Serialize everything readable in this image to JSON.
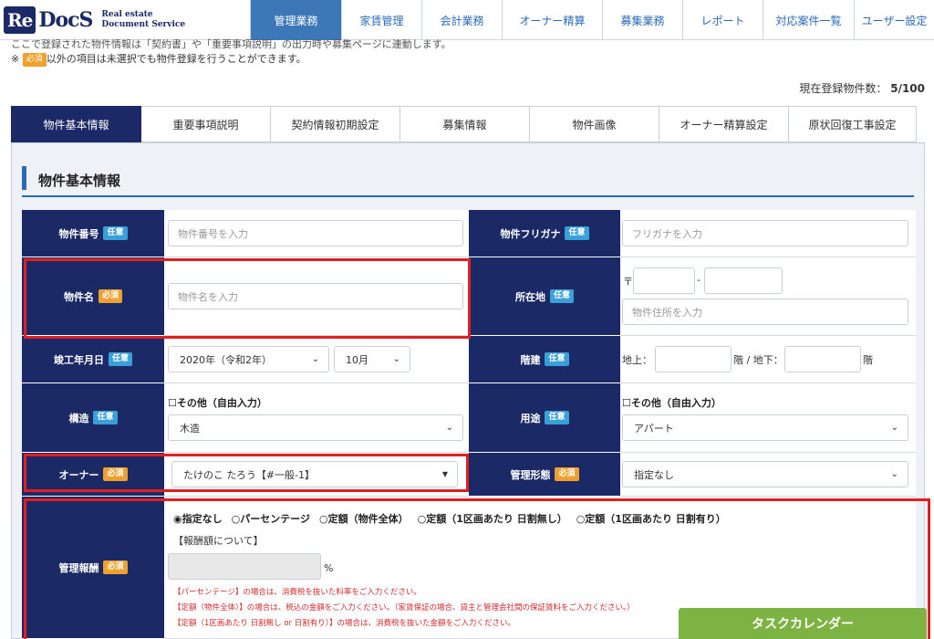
{
  "logo": {
    "mark": "Re",
    "word": "DocS",
    "sub1": "Real estate",
    "sub2": "Document Service"
  },
  "nav": [
    {
      "label": "管理業務",
      "active": true
    },
    {
      "label": "家賃管理"
    },
    {
      "label": "会計業務"
    },
    {
      "label": "オーナー精算"
    },
    {
      "label": "募集業務"
    },
    {
      "label": "レポート"
    },
    {
      "label": "対応案件一覧"
    },
    {
      "label": "ユーザー設定"
    }
  ],
  "notice": {
    "line1": "ここで登録された物件情報は「契約書」や「重要事項説明」の出力時や募集ページに連動します。",
    "line2_prefix": "※",
    "line2_badge": "必須",
    "line2_suffix": "以外の項目は未選択でも物件登録を行うことができます。"
  },
  "count": {
    "label": "現在登録物件数：",
    "value": "5/100"
  },
  "tabs": [
    "物件基本情報",
    "重要事項説明",
    "契約情報初期設定",
    "募集情報",
    "物件画像",
    "オーナー精算設定",
    "原状回復工事設定"
  ],
  "section_title": "物件基本情報",
  "badges": {
    "required": "必須",
    "optional": "任意"
  },
  "fields": {
    "property_number": {
      "label": "物件番号",
      "placeholder": "物件番号を入力"
    },
    "property_kana": {
      "label": "物件フリガナ",
      "placeholder": "フリガナを入力"
    },
    "property_name": {
      "label": "物件名",
      "placeholder": "物件名を入力"
    },
    "address": {
      "label": "所在地",
      "postal_mark": "〒",
      "dash": "-",
      "placeholder": "物件住所を入力"
    },
    "built_date": {
      "label": "竣工年月日",
      "year": "2020年（令和2年）",
      "month": "10月"
    },
    "floors": {
      "label": "階建",
      "above": "地上：",
      "mid": "階 / 地下：",
      "below_unit": "階"
    },
    "structure": {
      "label": "構造",
      "other": "☐その他（自由入力）",
      "value": "木造"
    },
    "usage": {
      "label": "用途",
      "other": "☐その他（自由入力）",
      "value": "アパート"
    },
    "owner": {
      "label": "オーナー",
      "value": "たけのこ たろう【#一般-1】"
    },
    "mgmt_type": {
      "label": "管理形態",
      "value": "指定なし"
    },
    "mgmt_fee": {
      "label": "管理報酬",
      "options": [
        "◉指定なし",
        "○パーセンテージ",
        "○定額（物件全体）",
        "○定額（1区画あたり 日割無し）",
        "○定額（1区画あたり 日割有り）"
      ],
      "link": "【報酬額について】",
      "unit": "%",
      "notes": [
        "【パーセンテージ】の場合は、消費税を抜いた料率をご入力ください。",
        "【定額（物件全体）】の場合は、税込の金額をご入力ください。（家賃保証の場合、貸主と管理会社間の保証賃料をご入力ください。）",
        "【定額（1区画あたり 日割無し or 日割有り）】の場合は、消費税を抜いた金額をご入力ください。"
      ]
    }
  },
  "task_button": "タスクカレンダー",
  "colors": {
    "navy": "#1b2a66",
    "accent": "#2a6bb8",
    "required": "#f0a02c",
    "optional": "#3aa0d8",
    "highlight": "#e02020",
    "task": "#7cb342"
  }
}
